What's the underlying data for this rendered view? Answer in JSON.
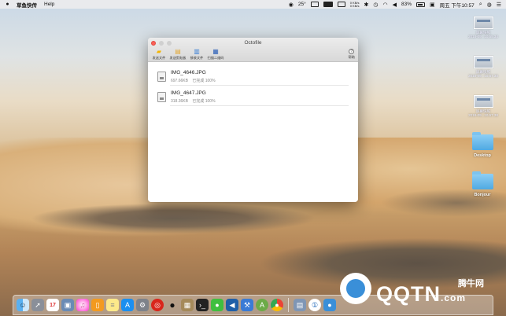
{
  "menubar": {
    "apple": "",
    "app_name": "草鱼快传",
    "help": "Help",
    "temperature": "25°",
    "net_up": "0 KB/s",
    "net_down": "0 KB/s",
    "battery": "83%",
    "clock": "周五 下午10:57"
  },
  "desktop": {
    "screenshots": [
      {
        "label_line1": "屏幕快照",
        "label_line2": "2018-09...10.55.34"
      },
      {
        "label_line1": "屏幕快照",
        "label_line2": "2018-09...10.57.30"
      },
      {
        "label_line1": "屏幕快照",
        "label_line2": "2018-09...10.57.38"
      }
    ],
    "folders": [
      {
        "label": "Desktop"
      },
      {
        "label": "Bonjour"
      }
    ]
  },
  "window": {
    "title": "Octofile",
    "toolbar": [
      {
        "label": "发送文件",
        "icon": "folder-icon"
      },
      {
        "label": "发送剪贴板",
        "icon": "clipboard-icon"
      },
      {
        "label": "接收文件",
        "icon": "receive-icon"
      },
      {
        "label": "扫描二维码",
        "icon": "qrcode-icon"
      }
    ],
    "help_label": "帮助",
    "help_glyph": "?",
    "files": [
      {
        "name": "IMG_4646.JPG",
        "size": "697.66KB",
        "status": "已完成 100%"
      },
      {
        "name": "IMG_4647.JPG",
        "size": "318.36KB",
        "status": "已完成 100%"
      }
    ]
  },
  "dock": {
    "icons": [
      "finder-icon",
      "launchpad-icon",
      "calendar-icon",
      "photos-icon",
      "itunes-icon",
      "ibooks-icon",
      "notes-icon",
      "appstore-icon",
      "system-preferences-icon",
      "netease-music-icon",
      "qq-icon",
      "archive-icon",
      "terminal-icon",
      "wechat-icon",
      "vscode-icon",
      "xcode-icon",
      "android-studio-icon",
      "chrome-icon",
      "file-manager-icon",
      "one-password-icon",
      "app-icon"
    ],
    "calendar_day": "17"
  },
  "watermark": {
    "text": "QQTN",
    "suffix": ".com",
    "cn": "腾牛网"
  }
}
